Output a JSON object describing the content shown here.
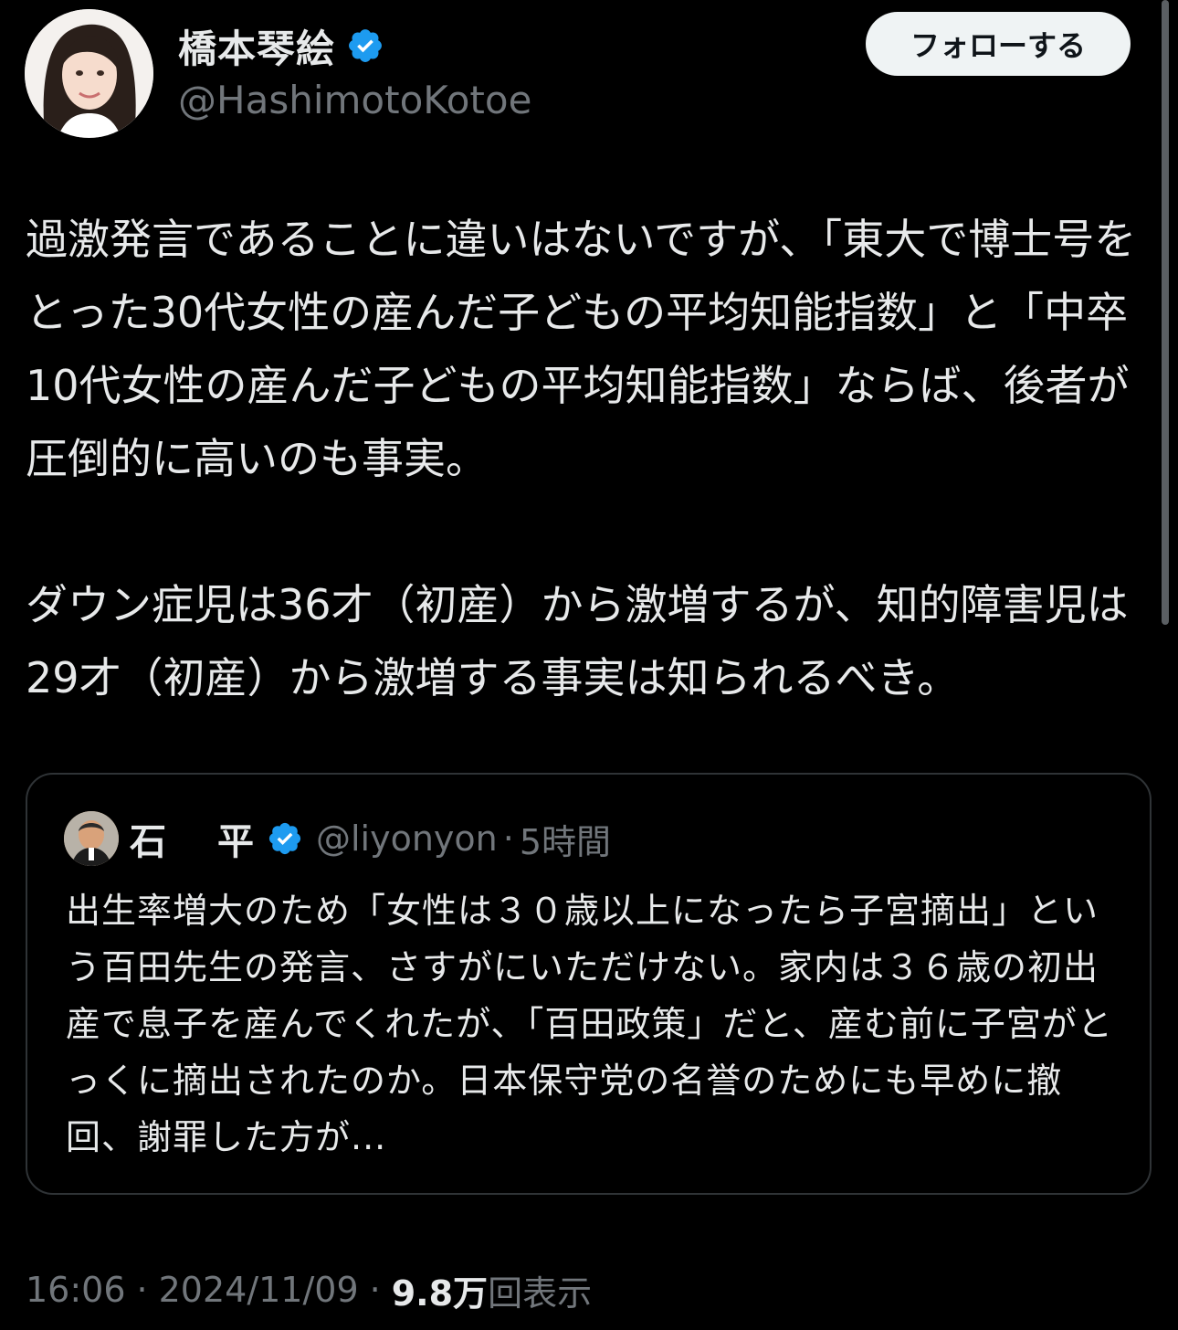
{
  "author": {
    "display_name": "橋本琴絵",
    "handle": "@HashimotoKotoe",
    "verified": true,
    "avatar_icon": "profile-photo"
  },
  "follow_button": {
    "label": "フォローする"
  },
  "tweet": {
    "paragraphs": [
      "過激発言であることに違いはないですが、「東大で博士号をとった30代女性の産んだ子どもの平均知能指数」と「中卒10代女性の産んだ子どもの平均知能指数」ならば、後者が圧倒的に高いのも事実。",
      "ダウン症児は36才（初産）から激増するが、知的障害児は29才（初産）から激増する事実は知られるべき。"
    ]
  },
  "quote": {
    "display_name": "石　平",
    "handle": "@liyonyon",
    "separator": "·",
    "time": "5時間",
    "verified": true,
    "body": "出生率増大のため「女性は３０歳以上になったら子宮摘出」という百田先生の発言、さすがにいただけない。家内は３６歳の初出産で息子を産んでくれたが、「百田政策」だと、産む前に子宮がとっくに摘出されたのか。日本保守党の名誉のためにも早めに撤回、謝罪した方が..."
  },
  "meta": {
    "time": "16:06",
    "date": "2024/11/09",
    "separator": "·",
    "views_count": "9.8万",
    "views_label": "回表示"
  },
  "colors": {
    "background": "#000000",
    "text": "#e7e9ea",
    "secondary_text": "#71767b",
    "verified_blue": "#1d9bf0",
    "border": "#2f3336",
    "follow_bg": "#eff3f4"
  }
}
